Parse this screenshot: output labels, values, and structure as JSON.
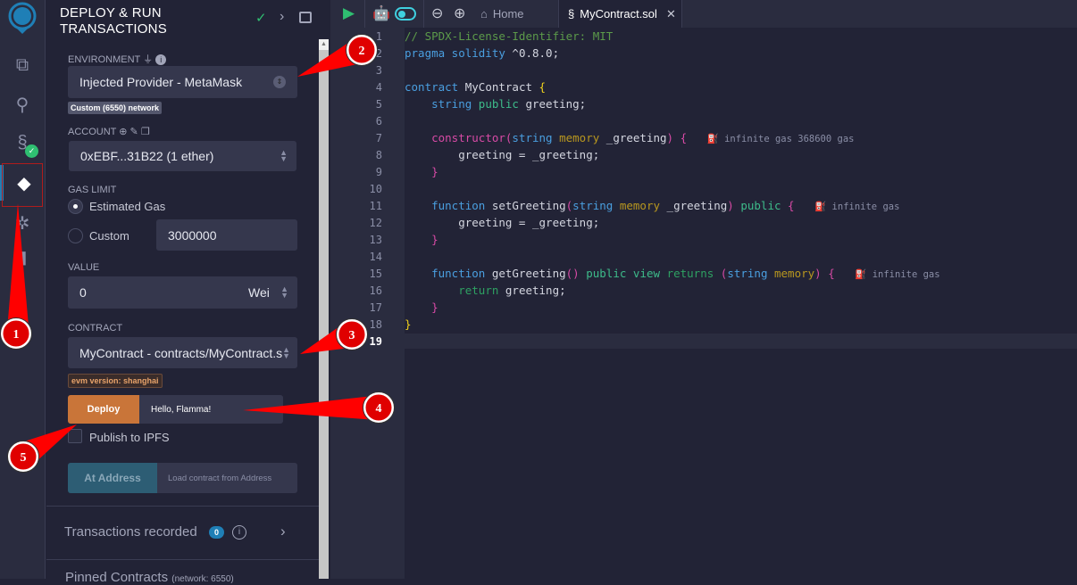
{
  "iconbar": {
    "items": [
      "remix-logo-icon",
      "file-explorer-icon",
      "search-icon",
      "solidity-compiler-icon",
      "deploy-run-icon",
      "debugger-icon",
      "plugin-icon"
    ]
  },
  "panel": {
    "title": "DEPLOY & RUN TRANSACTIONS",
    "environment": {
      "label": "ENVIRONMENT",
      "value": "Injected Provider - MetaMask",
      "network_badge": "Custom (6550) network"
    },
    "account": {
      "label": "ACCOUNT",
      "value": "0xEBF...31B22 (1 ether)"
    },
    "gas_limit": {
      "label": "GAS LIMIT",
      "estimated": "Estimated Gas",
      "custom": "Custom",
      "custom_value": "3000000",
      "selected": "Estimated Gas"
    },
    "value": {
      "label": "VALUE",
      "amount": "0",
      "unit": "Wei"
    },
    "contract": {
      "label": "CONTRACT",
      "value": "MyContract - contracts/MyContract.s",
      "evm_badge": "evm version: shanghai"
    },
    "deploy": {
      "button": "Deploy",
      "input": "Hello, Flamma!"
    },
    "publish_ipfs": {
      "label": "Publish to IPFS",
      "checked": false
    },
    "at_address": {
      "button": "At Address",
      "placeholder": "Load contract from Address"
    },
    "transactions": {
      "label": "Transactions recorded",
      "count": "0"
    },
    "pinned": {
      "label": "Pinned Contracts",
      "sub": "(network: 6550)"
    }
  },
  "editor": {
    "tabs": [
      {
        "label": "Home"
      },
      {
        "label": "MyContract.sol",
        "active": true
      }
    ],
    "line_numbers": [
      "1",
      "2",
      "3",
      "4",
      "5",
      "6",
      "7",
      "8",
      "9",
      "10",
      "11",
      "12",
      "13",
      "14",
      "15",
      "16",
      "17",
      "18",
      "19"
    ],
    "gas": {
      "constructor": "infinite gas 368600 gas",
      "setGreeting": "infinite gas",
      "getGreeting": "infinite gas"
    },
    "current_line": 19
  },
  "annotations": [
    "1",
    "2",
    "3",
    "4",
    "5"
  ],
  "colors": {
    "accent_deploy": "#c97539",
    "at_address": "#2d5d74",
    "annotation": "#ff0000",
    "check": "#2fbf71"
  }
}
